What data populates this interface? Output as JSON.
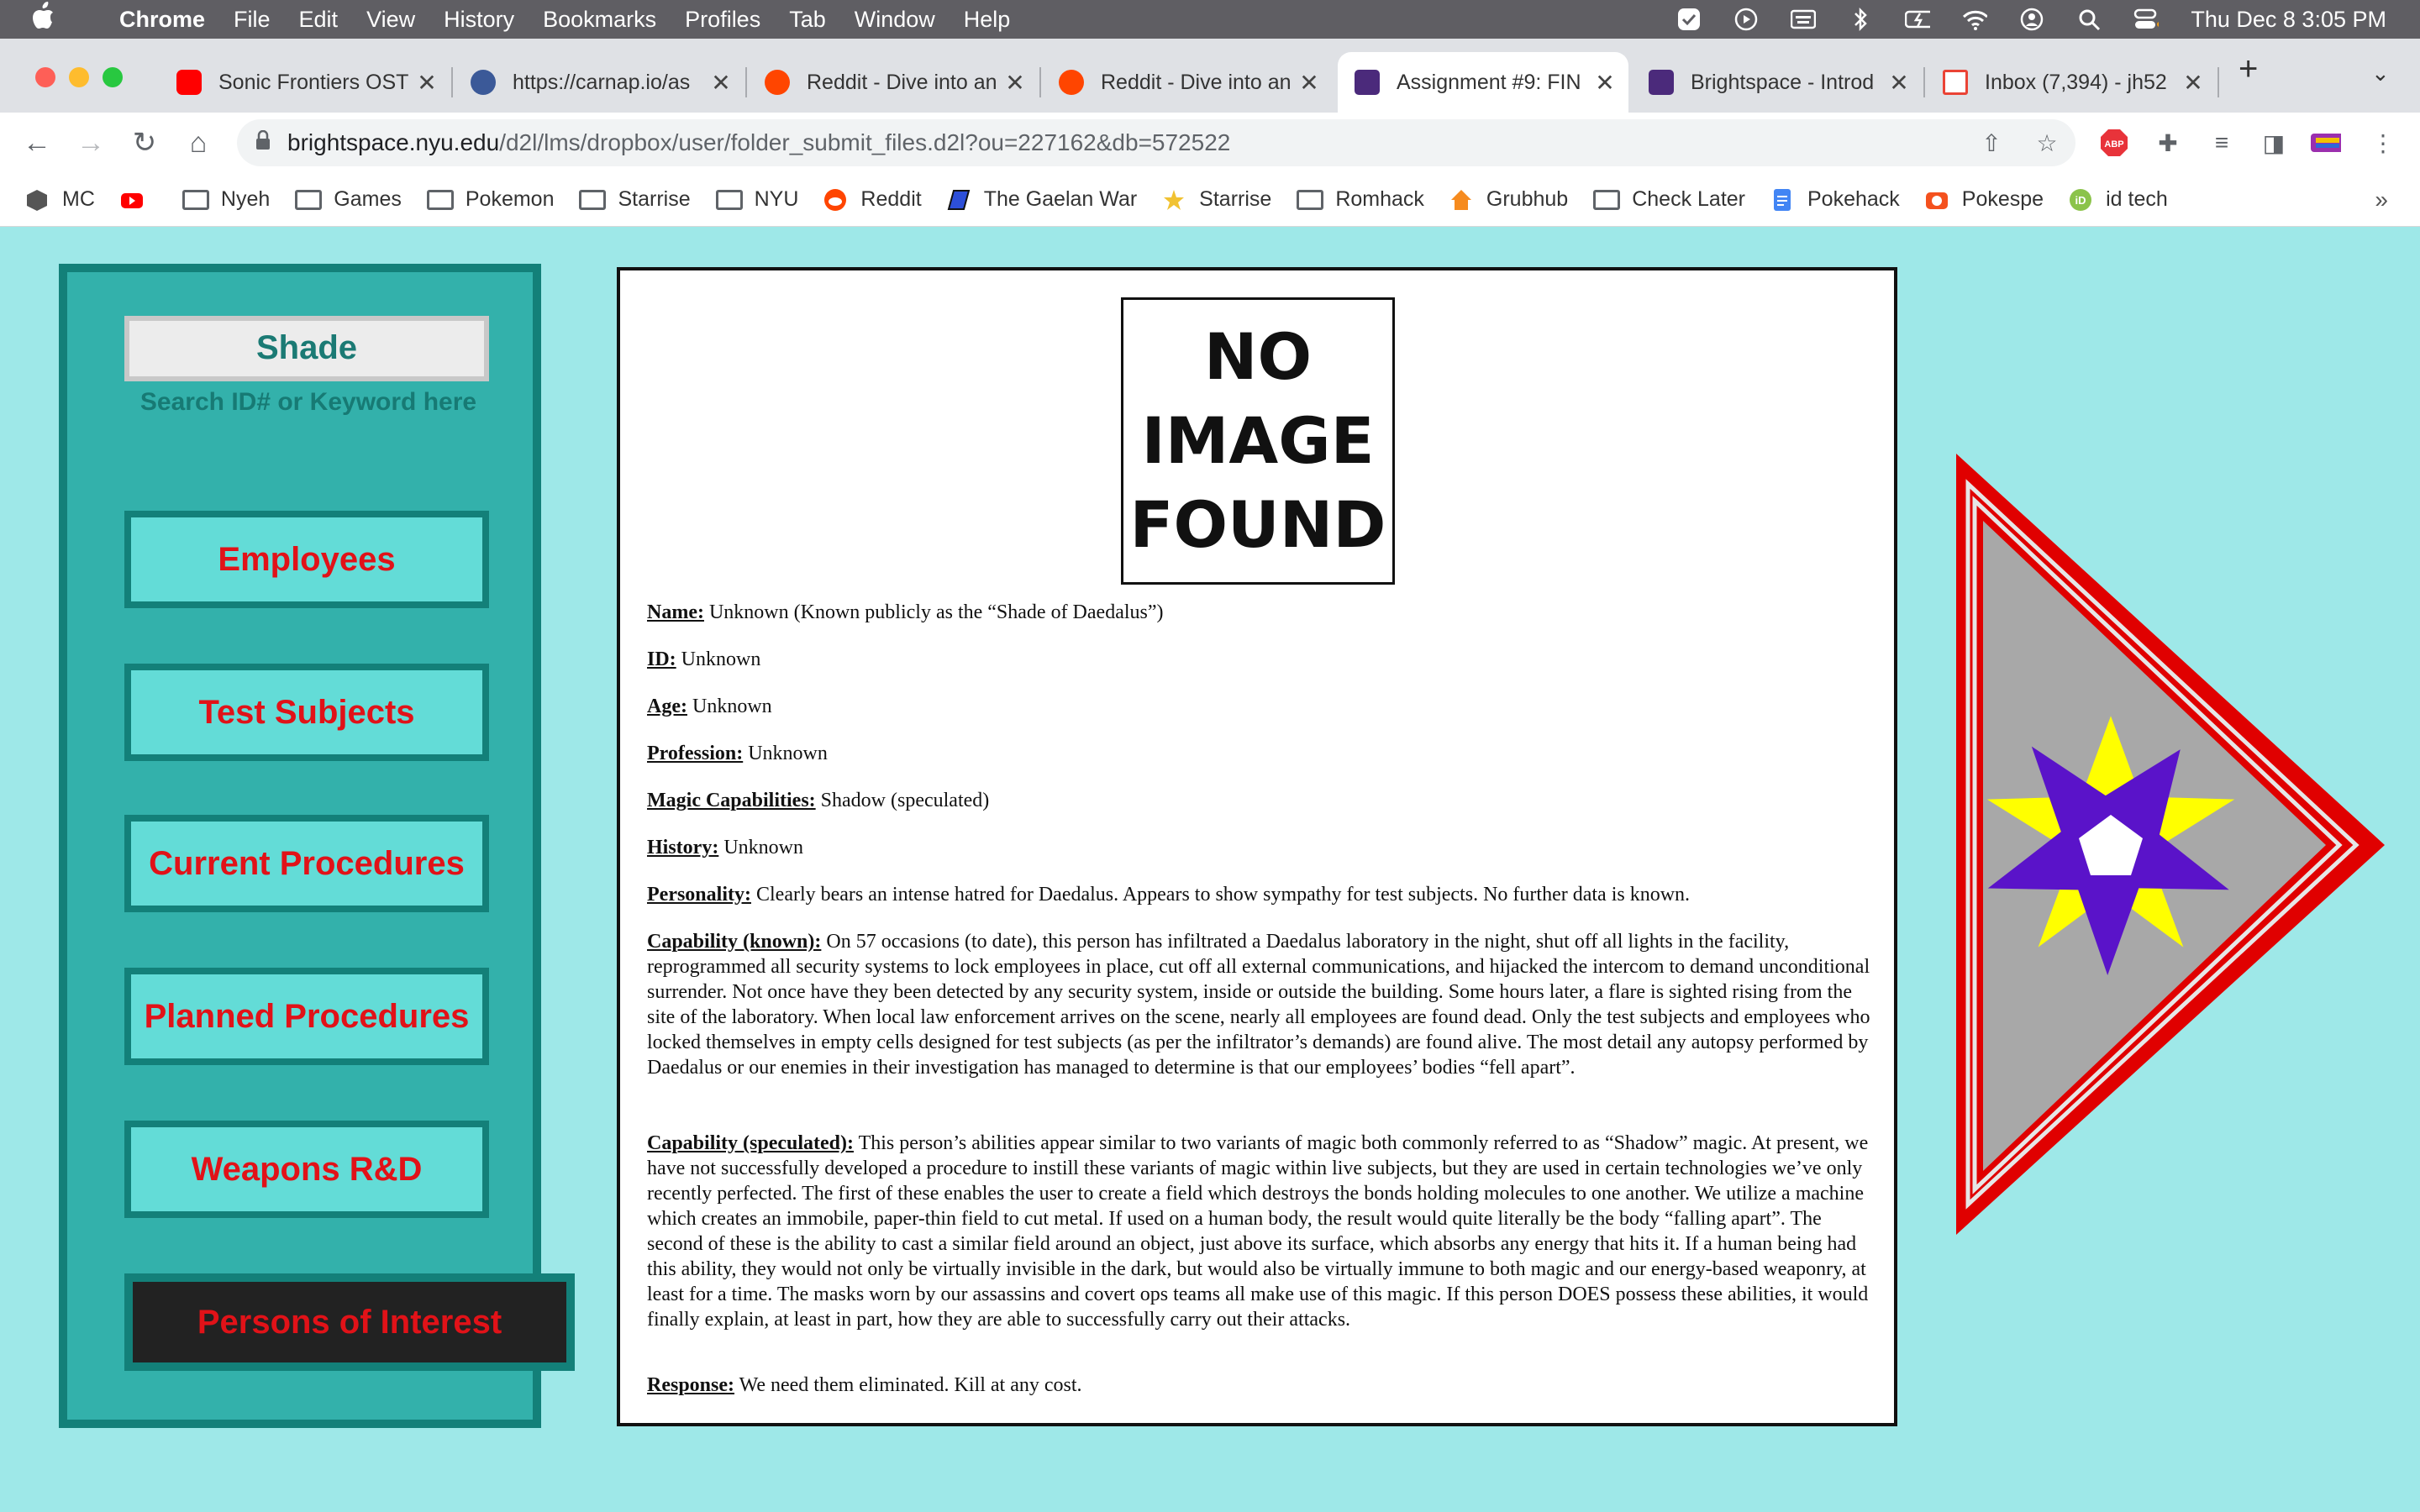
{
  "menubar": {
    "app": "Chrome",
    "items": [
      "File",
      "Edit",
      "View",
      "History",
      "Bookmarks",
      "Profiles",
      "Tab",
      "Window",
      "Help"
    ],
    "clock": "Thu Dec 8  3:05 PM"
  },
  "tabs": [
    {
      "title": "Sonic Frontiers OST",
      "favicon_color": "#ff0000",
      "active": false
    },
    {
      "title": "https://carnap.io/as",
      "favicon_color": "#3b5998",
      "active": false
    },
    {
      "title": "Reddit - Dive into an",
      "favicon_color": "#ff4500",
      "active": false
    },
    {
      "title": "Reddit - Dive into an",
      "favicon_color": "#ff4500",
      "active": false
    },
    {
      "title": "Assignment #9: FIN",
      "favicon_color": "#4b2a7b",
      "active": true
    },
    {
      "title": "Brightspace - Introd",
      "favicon_color": "#4b2a7b",
      "active": false
    },
    {
      "title": "Inbox (7,394) - jh52",
      "favicon_color": "#ea4335",
      "active": false
    }
  ],
  "address": {
    "host": "brightspace.nyu.edu",
    "path": "/d2l/lms/dropbox/user/folder_submit_files.d2l?ou=227162&db=572522"
  },
  "bookmarks": [
    {
      "label": "MC",
      "icon": "cube-icon"
    },
    {
      "label": "",
      "icon": "youtube-icon"
    },
    {
      "label": "Nyeh",
      "icon": "folder-icon"
    },
    {
      "label": "Games",
      "icon": "folder-icon"
    },
    {
      "label": "Pokemon",
      "icon": "folder-icon"
    },
    {
      "label": "Starrise",
      "icon": "folder-icon"
    },
    {
      "label": "NYU",
      "icon": "folder-icon"
    },
    {
      "label": "Reddit",
      "icon": "reddit-icon"
    },
    {
      "label": "The Gaelan War",
      "icon": "book-icon"
    },
    {
      "label": "Starrise",
      "icon": "star-icon"
    },
    {
      "label": "Romhack",
      "icon": "folder-icon"
    },
    {
      "label": "Grubhub",
      "icon": "grubhub-icon"
    },
    {
      "label": "Check Later",
      "icon": "folder-icon"
    },
    {
      "label": "Pokehack",
      "icon": "doc-icon"
    },
    {
      "label": "Pokespe",
      "icon": "camera-icon"
    },
    {
      "label": "id tech",
      "icon": "idtech-icon"
    }
  ],
  "sidebar": {
    "search_value": "Shade",
    "search_hint": "Search ID# or Keyword here",
    "nav": [
      "Employees",
      "Test Subjects",
      "Current Procedures",
      "Planned Procedures",
      "Weapons R&D",
      "Persons of Interest"
    ],
    "active_index": 5
  },
  "profile": {
    "no_image": [
      "NO",
      "IMAGE",
      "FOUND"
    ],
    "fields": [
      {
        "label": "Name:",
        "value": " Unknown (Known publicly as the “Shade of Daedalus”)"
      },
      {
        "label": "ID:",
        "value": " Unknown"
      },
      {
        "label": "Age:",
        "value": " Unknown"
      },
      {
        "label": "Profession:",
        "value": " Unknown"
      },
      {
        "label": "Magic Capabilities:",
        "value": " Shadow (speculated)"
      },
      {
        "label": "History:",
        "value": " Unknown"
      },
      {
        "label": "Personality:",
        "value": " Clearly bears an intense hatred for Daedalus. Appears to show sympathy for test subjects. No further data is known."
      },
      {
        "label": "Capability (known):",
        "value": " On 57 occasions (to date), this person has infiltrated a Daedalus laboratory in the night, shut off all lights in the facility, reprogrammed all security systems to lock employees in place, cut off all external communications, and hijacked the intercom to demand unconditional surrender. Not once have they been detected by any security system, inside or outside the building. Some hours later, a flare is sighted rising from the site of the laboratory. When local law enforcement arrives on the scene, nearly all employees are found dead. Only the test subjects and employees who locked themselves in empty cells designed for test subjects (as per the infiltrator’s demands) are found alive. The most detail any autopsy performed by Daedalus or our enemies in their investigation has managed to determine is that our employees’ bodies “fell apart”."
      },
      {
        "label": "Capability (speculated):",
        "value": " This person’s abilities appear similar to two variants of magic both commonly referred to as “Shadow” magic. At present, we have not successfully developed a procedure to instill these variants of magic within live subjects, but they are used in certain technologies we’ve only recently perfected. The first of these enables the user to create a field which destroys the bonds holding molecules to one another. We utilize a machine which creates an immobile, paper-thin field to cut metal. If used on a human body, the result would quite literally be the body “falling apart”. The second of these is the ability to cast a similar field around an object, just above its surface, which absorbs any energy that hits it. If a human being had this ability, they would not only be virtually invisible in the dark, but would also be virtually immune to both magic and our energy-based weaponry, at least for a time. The masks worn by our assassins and covert ops teams all make use of this magic. If this person DOES possess these abilities, it would finally explain, at least in part, how they are able to successfully carry out their attacks."
      },
      {
        "label": "Response:",
        "value": " We need them eliminated. Kill at any cost."
      }
    ]
  },
  "colors": {
    "page_bg": "#9ee8e8",
    "sidebar_bg": "#33b1ab",
    "nav_text": "#e11218",
    "badge_red": "#e00000",
    "badge_purple": "#5a13c9",
    "badge_yellow": "#ffff00"
  }
}
